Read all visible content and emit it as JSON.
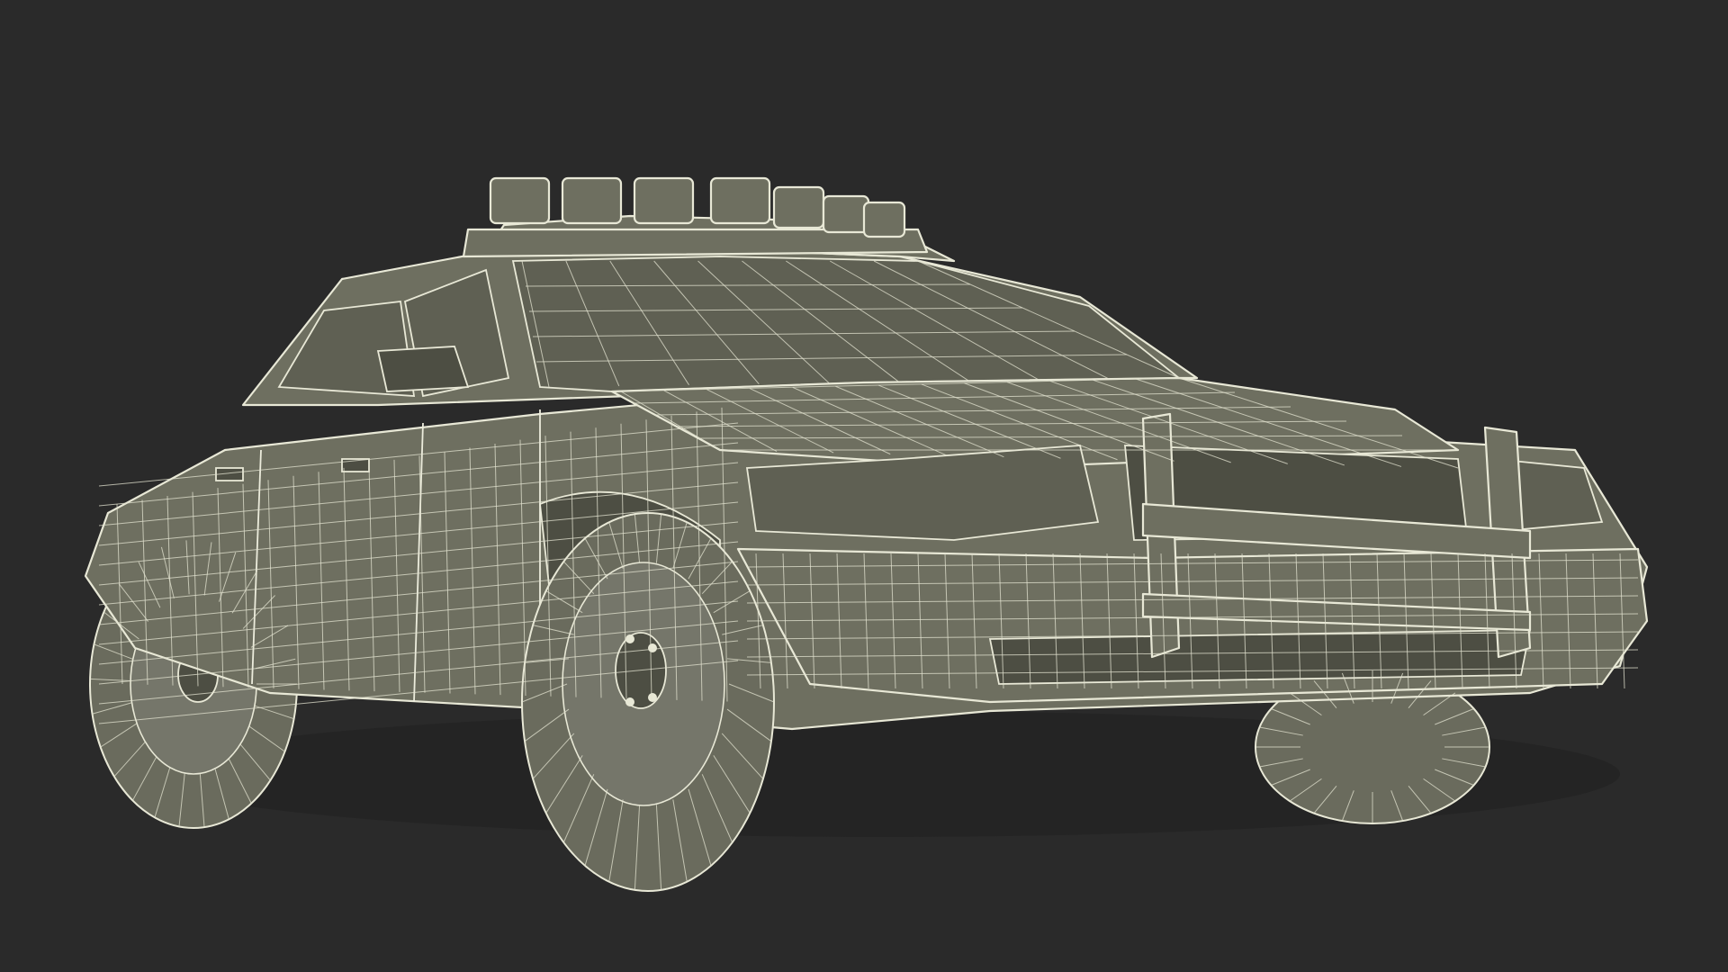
{
  "scene": {
    "subject": "police-car-wireframe",
    "background_color": "#2a2a2a",
    "body_color": "#6e6f60",
    "wire_color": "#e8e8d6"
  }
}
